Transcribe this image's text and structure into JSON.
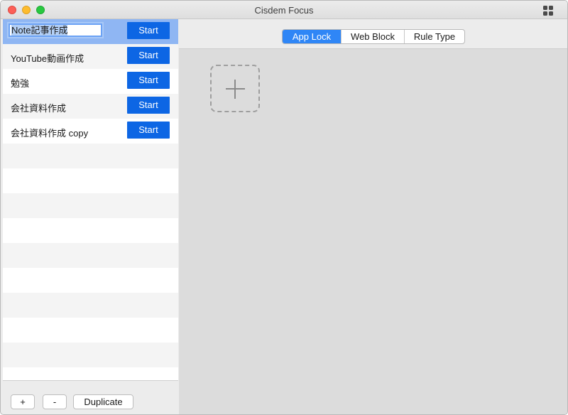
{
  "window": {
    "title": "Cisdem Focus"
  },
  "rules": [
    {
      "name": "Note記事作成",
      "editing": true,
      "start_label": "Start"
    },
    {
      "name": "YouTube動画作成",
      "start_label": "Start"
    },
    {
      "name": "勉強",
      "start_label": "Start"
    },
    {
      "name": "会社資料作成",
      "start_label": "Start"
    },
    {
      "name": "会社資料作成 copy",
      "start_label": "Start"
    }
  ],
  "bottom": {
    "add_label": "+",
    "remove_label": "-",
    "duplicate_label": "Duplicate"
  },
  "tabs": [
    {
      "label": "App Lock",
      "active": true
    },
    {
      "label": "Web Block",
      "active": false
    },
    {
      "label": "Rule Type",
      "active": false
    }
  ],
  "colors": {
    "accent": "#0d66e4",
    "selected_row": "#8fb6f3",
    "active_tab": "#2f86f6"
  },
  "icons": {
    "add_app": "plus-icon",
    "view_toggle": "grid-icon"
  }
}
